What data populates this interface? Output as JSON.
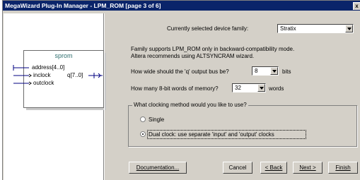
{
  "window": {
    "title": "MegaWizard Plug-In Manager - LPM_ROM [page 3 of 6]",
    "close_label": "x"
  },
  "symbol": {
    "name": "sprom",
    "pins_in": [
      "address[4..0]",
      "inclock",
      "outclock"
    ],
    "pin_out": "q[7..0]"
  },
  "device_family": {
    "label": "Currently selected device family:",
    "value": "Stratix"
  },
  "notice": [
    "Family supports LPM_ROM only in backward-compatibility mode.",
    "Altera recommends using ALTSYNCRAM wizard."
  ],
  "q_width": {
    "label": "How wide should the 'q' output bus be?",
    "value": "8",
    "unit": "bits"
  },
  "words": {
    "label": "How many 8-bit words of memory?",
    "value": "32",
    "unit": "words"
  },
  "clocking": {
    "title": "What clocking method would you like to use?",
    "options": [
      {
        "label": "Single",
        "selected": false
      },
      {
        "label": "Dual clock: use separate 'input' and 'output' clocks",
        "selected": true
      }
    ]
  },
  "buttons": {
    "documentation": "Documentation...",
    "cancel": "Cancel",
    "back": "< Back",
    "next": "Next >",
    "finish": "Finish"
  }
}
